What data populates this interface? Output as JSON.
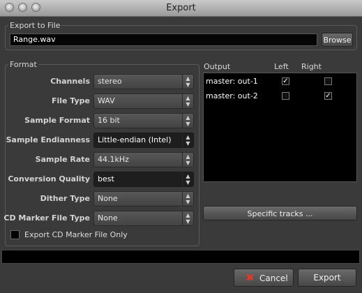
{
  "window": {
    "title": "Export"
  },
  "export_to_file": {
    "label": "Export to File",
    "filename": "Range.wav",
    "browse_label": "Browse"
  },
  "format": {
    "label": "Format",
    "rows": [
      {
        "label": "Channels",
        "value": "stereo"
      },
      {
        "label": "File Type",
        "value": "WAV"
      },
      {
        "label": "Sample Format",
        "value": "16 bit"
      },
      {
        "label": "Sample Endianness",
        "value": "Little-endian (Intel)"
      },
      {
        "label": "Sample Rate",
        "value": "44.1kHz"
      },
      {
        "label": "Conversion Quality",
        "value": "best"
      },
      {
        "label": "Dither Type",
        "value": "None"
      },
      {
        "label": "CD Marker File Type",
        "value": "None"
      }
    ],
    "cd_only_label": "Export CD Marker File Only"
  },
  "output": {
    "headers": {
      "output": "Output",
      "left": "Left",
      "right": "Right"
    },
    "rows": [
      {
        "name": "master: out-1",
        "left": true,
        "right": false
      },
      {
        "name": "master: out-2",
        "left": false,
        "right": true
      }
    ],
    "specific_tracks_label": "Specific tracks ..."
  },
  "footer": {
    "cancel_label": "Cancel",
    "export_label": "Export"
  },
  "colors": {
    "cancel_icon": "#e03a2a"
  }
}
